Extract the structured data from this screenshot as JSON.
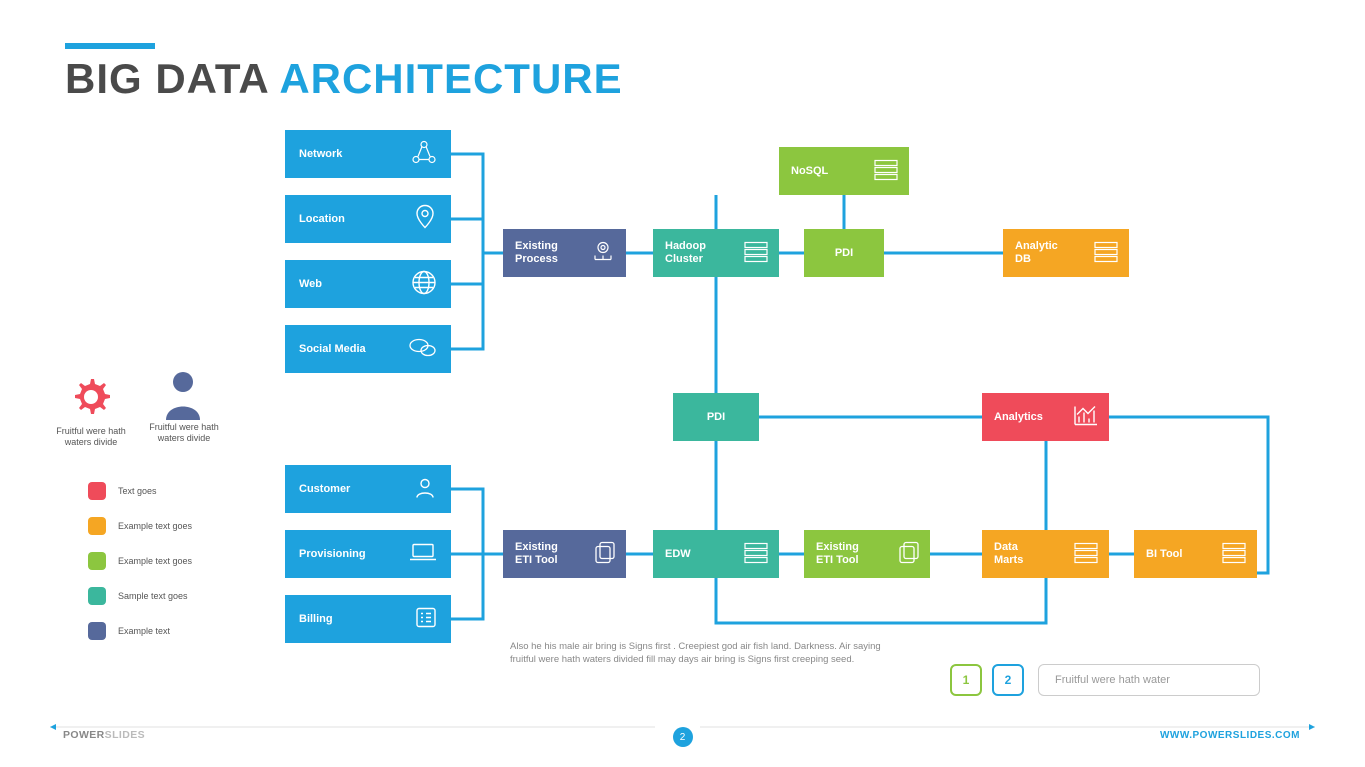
{
  "title": {
    "part1": "BIG DATA ",
    "part2": "ARCHITECTURE"
  },
  "sourcesTop": [
    {
      "label": "Network",
      "icon": "network-icon"
    },
    {
      "label": "Location",
      "icon": "location-icon"
    },
    {
      "label": "Web",
      "icon": "web-icon"
    },
    {
      "label": "Social Media",
      "icon": "chat-icon"
    }
  ],
  "sourcesBottom": [
    {
      "label": "Customer",
      "icon": "user-icon"
    },
    {
      "label": "Provisioning",
      "icon": "laptop-icon"
    },
    {
      "label": "Billing",
      "icon": "list-icon"
    }
  ],
  "nodes": {
    "existingProcess": "Existing\nProcess",
    "hadoop": "Hadoop\nCluster",
    "nosql": "NoSQL",
    "pdiTop": "PDI",
    "analyticDB": "Analytic\nDB",
    "pdiMid": "PDI",
    "analytics": "Analytics",
    "existingETI1": "Existing\nETI Tool",
    "edw": "EDW",
    "existingETI2": "Existing\nETI Tool",
    "dataMarts": "Data\nMarts",
    "biTool": "BI Tool"
  },
  "sideLegend": {
    "gearText": "Fruitful were hath waters divide",
    "personText": "Fruitful were hath waters divide"
  },
  "colorLegend": [
    {
      "color": "#ef4b5a",
      "label": "Text goes"
    },
    {
      "color": "#f5a623",
      "label": "Example text goes"
    },
    {
      "color": "#8cc63f",
      "label": "Example text goes"
    },
    {
      "color": "#3bb79d",
      "label": "Sample text goes"
    },
    {
      "color": "#56699b",
      "label": "Example text"
    }
  ],
  "caption": "Also he his male air bring is Signs first . Creepiest god air fish land. Darkness. Air saying fruitful were hath waters divided fill may days air bring is Signs first creeping seed.",
  "controls": {
    "opt1": "1",
    "opt2": "2",
    "placeholder": "Fruitful were hath water"
  },
  "footer": {
    "brand1": "POWER",
    "brand2": "SLIDES",
    "url": "WWW.POWERSLIDES.COM",
    "page": "2"
  }
}
